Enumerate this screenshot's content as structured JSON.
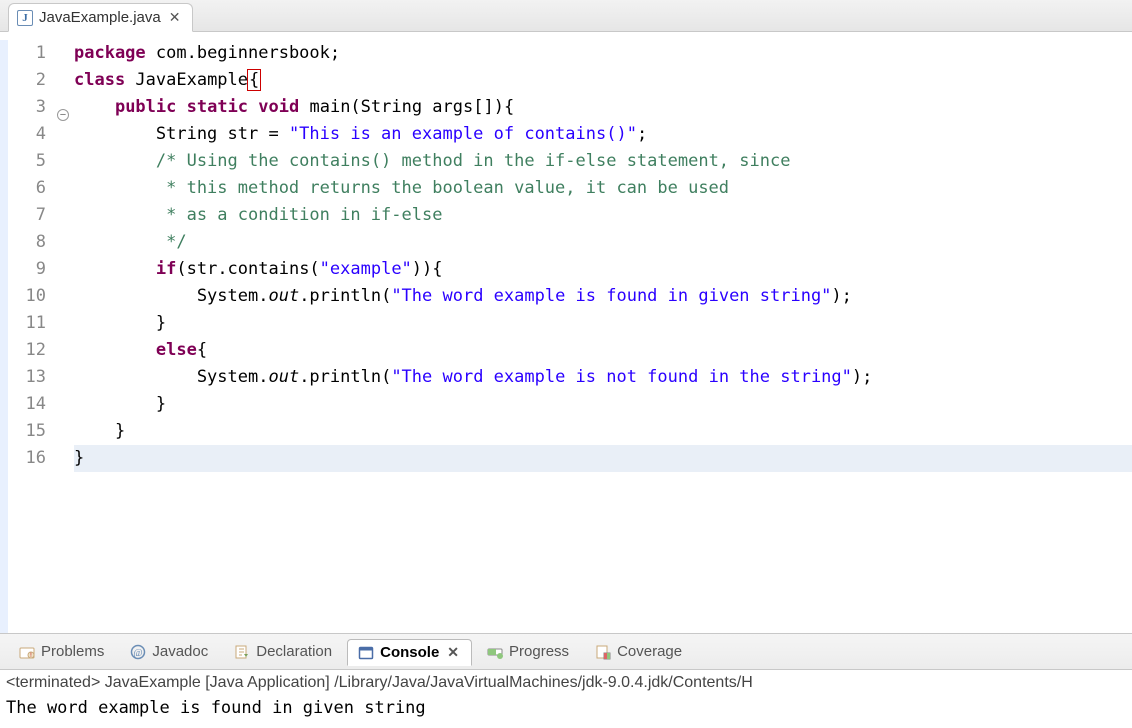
{
  "editor": {
    "tab": {
      "icon": "J",
      "filename": "JavaExample.java",
      "close": "✕"
    },
    "lines": [
      {
        "n": "1",
        "html": "<span class='k'>package</span> com.beginnersbook;"
      },
      {
        "n": "2",
        "html": "<span class='k'>class</span> JavaExample<span class='boxchar'>{</span>"
      },
      {
        "n": "3",
        "fold": true,
        "html": "    <span class='k'>public</span> <span class='k'>static</span> <span class='k'>void</span> main(String args[]){"
      },
      {
        "n": "4",
        "html": "        String str = <span class='s'>\"This is an example of contains()\"</span>;"
      },
      {
        "n": "5",
        "html": "        <span class='c'>/* Using the contains() method in the if-else statement, since</span>"
      },
      {
        "n": "6",
        "html": "<span class='c'>         * this method returns the boolean value, it can be used</span>"
      },
      {
        "n": "7",
        "html": "<span class='c'>         * as a condition in if-else</span>"
      },
      {
        "n": "8",
        "html": "<span class='c'>         */</span>"
      },
      {
        "n": "9",
        "html": "        <span class='k'>if</span>(str.contains(<span class='s'>\"example\"</span>)){"
      },
      {
        "n": "10",
        "html": "            System.<span class='f'>out</span>.println(<span class='s'>\"The word example is found in given string\"</span>);"
      },
      {
        "n": "11",
        "html": "        }"
      },
      {
        "n": "12",
        "html": "        <span class='k'>else</span>{"
      },
      {
        "n": "13",
        "html": "            System.<span class='f'>out</span>.println(<span class='s'>\"The word example is not found in the string\"</span>);"
      },
      {
        "n": "14",
        "html": "        }"
      },
      {
        "n": "15",
        "html": "    }"
      },
      {
        "n": "16",
        "current": true,
        "html": "}"
      }
    ]
  },
  "views": {
    "tabs": [
      {
        "id": "problems",
        "label": "Problems",
        "icon": "problems-icon"
      },
      {
        "id": "javadoc",
        "label": "Javadoc",
        "icon": "javadoc-icon"
      },
      {
        "id": "declaration",
        "label": "Declaration",
        "icon": "declaration-icon"
      },
      {
        "id": "console",
        "label": "Console",
        "icon": "console-icon",
        "active": true,
        "closable": true
      },
      {
        "id": "progress",
        "label": "Progress",
        "icon": "progress-icon"
      },
      {
        "id": "coverage",
        "label": "Coverage",
        "icon": "coverage-icon"
      }
    ]
  },
  "console": {
    "status": "<terminated> JavaExample [Java Application] /Library/Java/JavaVirtualMachines/jdk-9.0.4.jdk/Contents/H",
    "output": "The word example is found in given string"
  }
}
